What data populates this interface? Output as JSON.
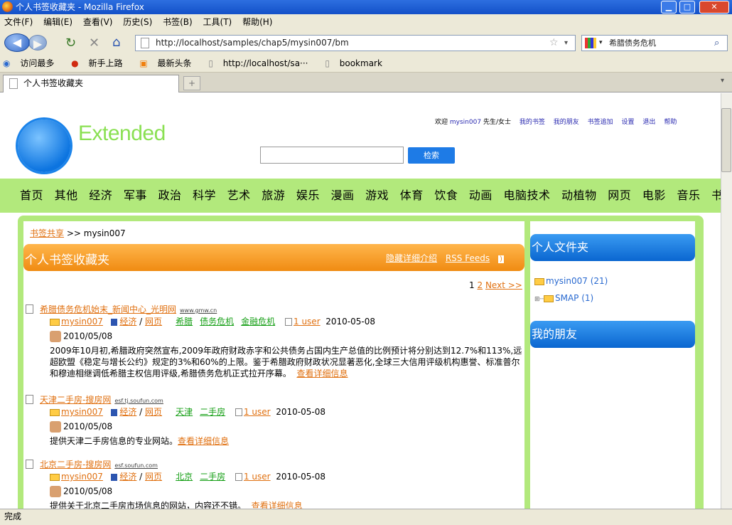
{
  "window": {
    "title": "个人书签收藏夹 - Mozilla Firefox",
    "minimize": "▁",
    "maximize": "□",
    "close": "✕"
  },
  "menu": [
    "文件(F)",
    "编辑(E)",
    "查看(V)",
    "历史(S)",
    "书签(B)",
    "工具(T)",
    "帮助(H)"
  ],
  "nav": {
    "url": "http://localhost/samples/chap5/mysin007/bm",
    "search_value": "希腊债务危机"
  },
  "bookmarks_bar": [
    "访问最多",
    "新手上路",
    "最新头条",
    "http://localhost/sa···",
    "bookmark"
  ],
  "tab": {
    "title": "个人书签收藏夹"
  },
  "status": "完成",
  "page": {
    "logo_text": "Extended",
    "top_links": {
      "welcome": "欢迎",
      "user": "mysin007",
      "salutation": "先生/女士",
      "links": [
        "我的书签",
        "我的朋友",
        "书签追加",
        "设置",
        "退出",
        "帮助"
      ]
    },
    "search_button": "检索",
    "categories": [
      "首页",
      "其他",
      "经济",
      "军事",
      "政治",
      "科学",
      "艺术",
      "旅游",
      "娱乐",
      "漫画",
      "游戏",
      "体育",
      "饮食",
      "动画",
      "电脑技术",
      "动植物",
      "网页",
      "电影",
      "音乐",
      "书籍"
    ],
    "breadcrumb": {
      "link": "书签共享",
      "sep": ">>",
      "current": "mysin007"
    },
    "section_title": "个人书签收藏夹",
    "hide_details": "隐藏详细介绍",
    "rss": "RSS Feeds",
    "pager": {
      "current": "1",
      "page2": "2",
      "next": "Next >>"
    },
    "items": [
      {
        "title": "希腊债务危机始末_新闻中心_光明网",
        "domain": "www.gmw.cn",
        "folder": "mysin007",
        "cat1": "经济",
        "cat2": "网页",
        "tags": [
          "希腊",
          "债务危机",
          "金融危机"
        ],
        "users": "1 user",
        "date1": "2010-05-08",
        "date2": "2010/05/08",
        "desc": "2009年10月初,希腊政府突然宣布,2009年政府财政赤字和公共债务占国内生产总值的比例预计将分别达到12.7%和113%,远超欧盟《稳定与增长公约》规定的3%和60%的上限。鉴于希腊政府财政状况显著恶化,全球三大信用评级机构惠誉、标准普尔和穆迪相继调低希腊主权信用评级,希腊债务危机正式拉开序幕。",
        "more": "查看详细信息"
      },
      {
        "title": "天津二手房-搜房网",
        "domain": "esf.tj.soufun.com",
        "folder": "mysin007",
        "cat1": "经济",
        "cat2": "网页",
        "tags": [
          "天津",
          "二手房"
        ],
        "users": "1 user",
        "date1": "2010-05-08",
        "date2": "2010/05/08",
        "desc": "提供天津二手房信息的专业网站。",
        "more": "查看详细信息"
      },
      {
        "title": "北京二手房-搜房网",
        "domain": "esf.soufun.com",
        "folder": "mysin007",
        "cat1": "经济",
        "cat2": "网页",
        "tags": [
          "北京",
          "二手房"
        ],
        "users": "1 user",
        "date1": "2010-05-08",
        "date2": "2010/05/08",
        "desc": "提供关于北京二手房市场信息的网站，内容还不错。",
        "more": "查看详细信息"
      }
    ],
    "side": {
      "folders_title": "个人文件夹",
      "folder_main": "mysin007 (21)",
      "folder_sub": "SMAP (1)",
      "friends_title": "我的朋友"
    }
  }
}
